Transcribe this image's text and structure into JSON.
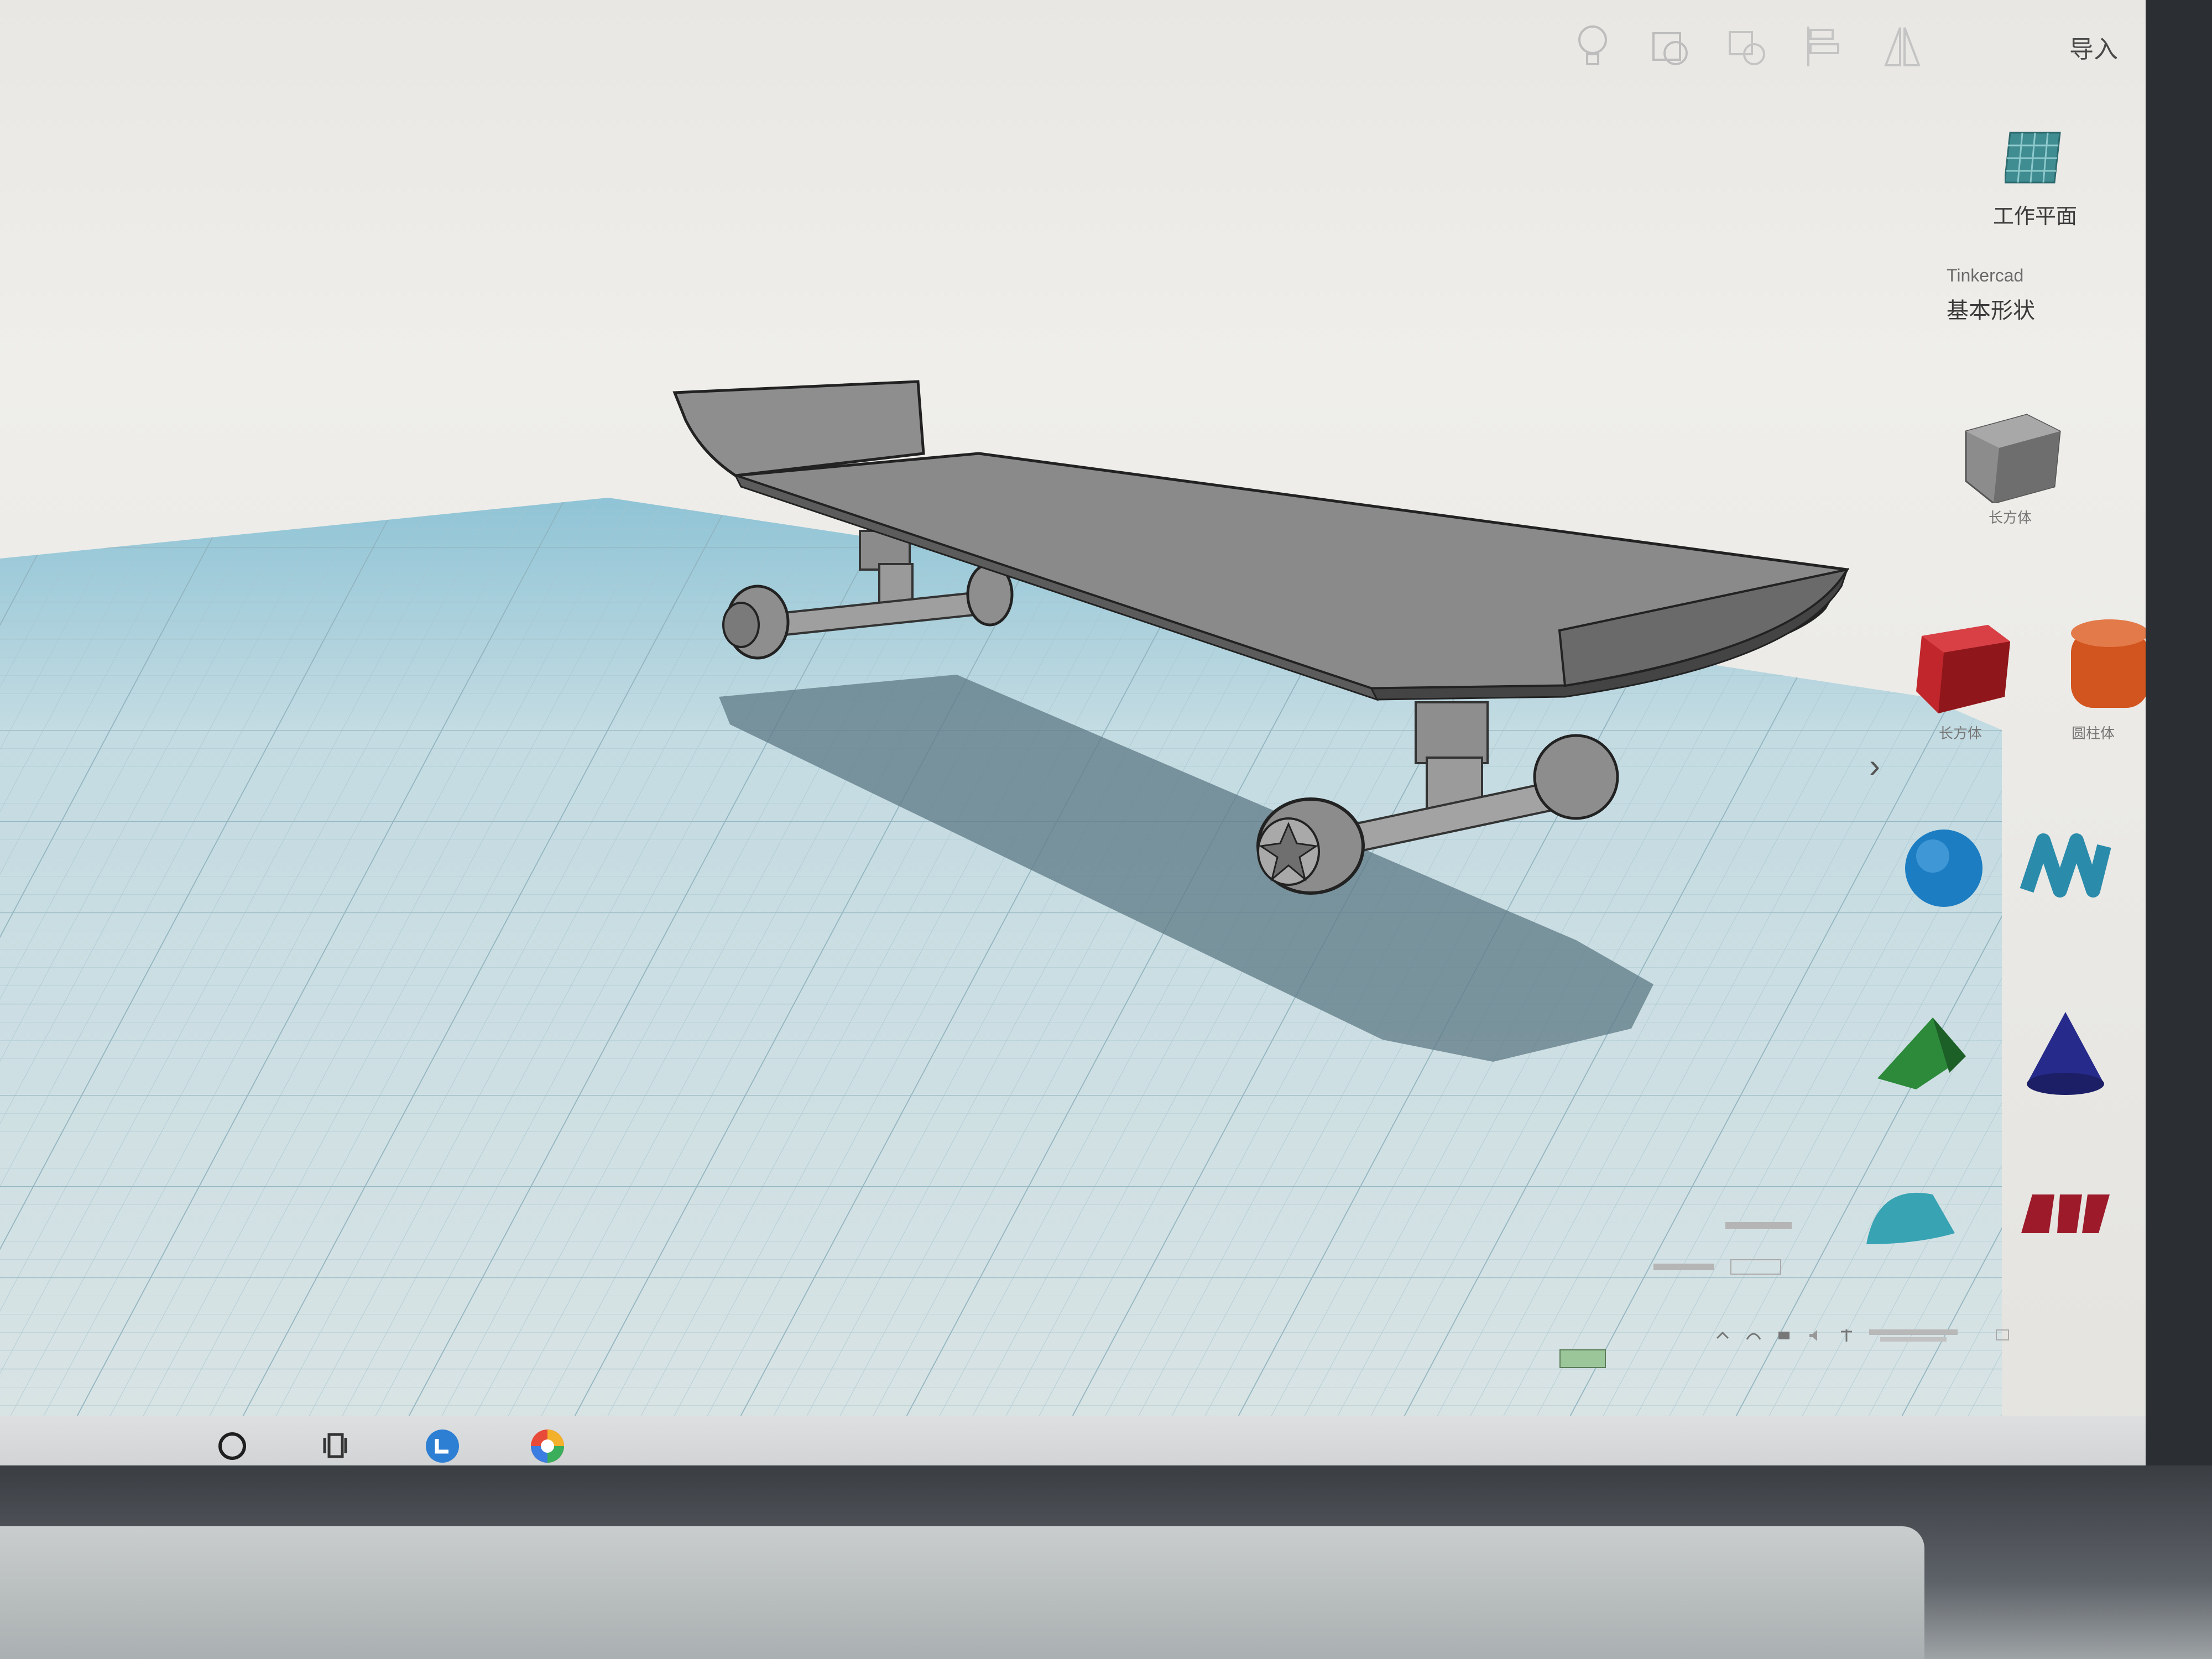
{
  "toolbar": {
    "icons": [
      "lightbulb-icon",
      "group-icon",
      "ungroup-icon",
      "align-icon",
      "mirror-icon"
    ],
    "import_label": "导入"
  },
  "side_panel": {
    "workplane_label": "工作平面",
    "library_source": "Tinkercad",
    "library_category": "基本形状",
    "shapes": [
      {
        "label": "长方体",
        "color": "#8c8c8c"
      },
      {
        "label": "长方体",
        "color": "#c0262b"
      },
      {
        "label": "圆柱体",
        "color": "#d2541e"
      },
      {
        "label": "",
        "color": "#1d7dc2"
      },
      {
        "label": "",
        "color": "#2a8bab"
      },
      {
        "label": "",
        "color": "#2c8a3a"
      },
      {
        "label": "",
        "color": "#262a8a"
      },
      {
        "label": "",
        "color": "#37a3b3"
      },
      {
        "label": "",
        "color": "#9c1a2a"
      }
    ],
    "collapse_glyph": "›"
  },
  "colors": {
    "grid_base": "#b7d3dc",
    "grid_line": "#9fbfc9",
    "model_gray": "#8f8f8f",
    "shadow": "#5e7a86"
  }
}
